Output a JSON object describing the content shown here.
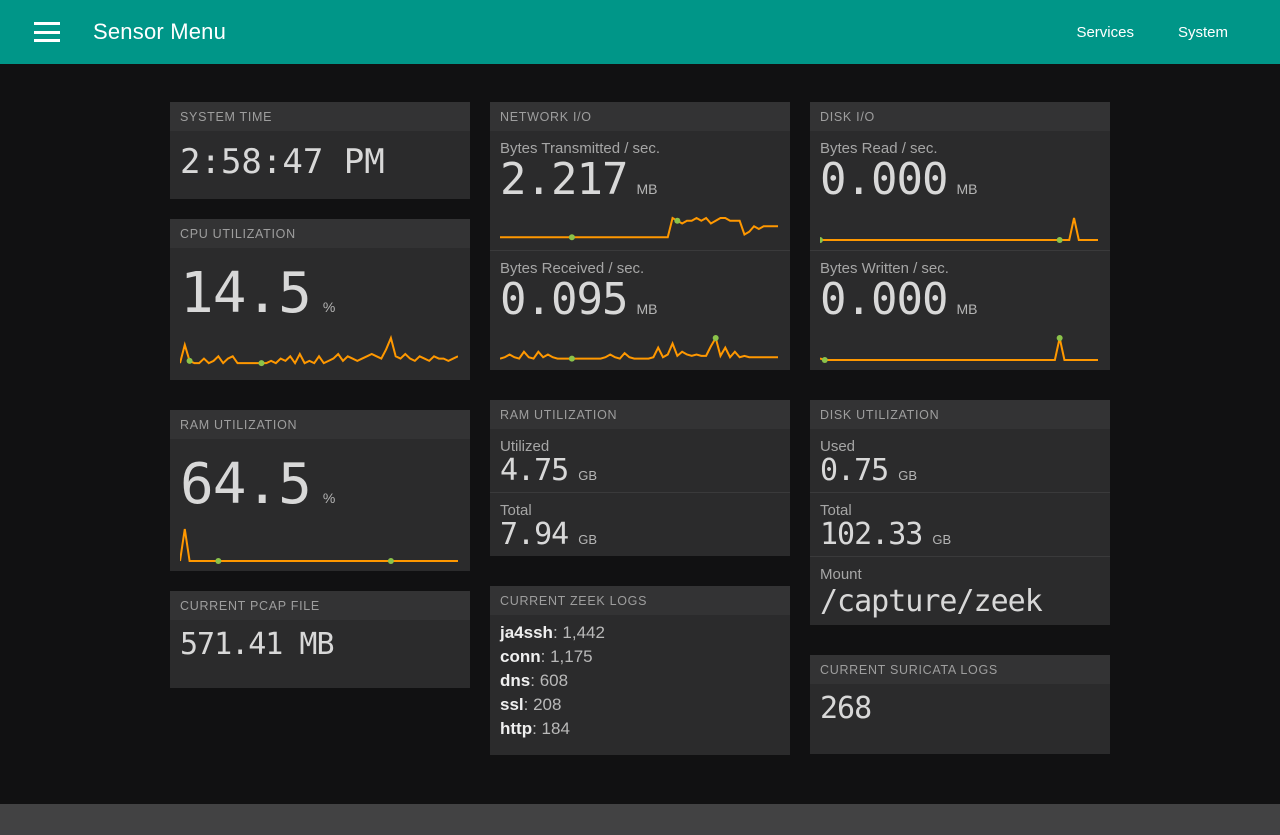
{
  "header": {
    "menu_icon": "hamburger-icon",
    "title": "Sensor Menu",
    "nav": [
      {
        "label": "Services"
      },
      {
        "label": "System"
      }
    ]
  },
  "cards": {
    "system_time": {
      "title": "SYSTEM TIME",
      "value": "2:58:47 PM"
    },
    "cpu_utilization": {
      "title": "CPU UTILIZATION",
      "value": "14.5",
      "unit": "%"
    },
    "ram_utilization_pct": {
      "title": "RAM UTILIZATION",
      "value": "64.5",
      "unit": "%"
    },
    "current_pcap_file": {
      "title": "CURRENT PCAP FILE",
      "value": "571.41 MB"
    },
    "network_io": {
      "title": "NETWORK I/O",
      "rows": [
        {
          "label": "Bytes Transmitted / sec.",
          "value": "2.217",
          "unit": "MB"
        },
        {
          "label": "Bytes Received / sec.",
          "value": "0.095",
          "unit": "MB"
        }
      ]
    },
    "ram_utilization_gb": {
      "title": "RAM UTILIZATION",
      "rows": [
        {
          "label": "Utilized",
          "value": "4.75",
          "unit": "GB"
        },
        {
          "label": "Total",
          "value": "7.94",
          "unit": "GB"
        }
      ]
    },
    "current_zeek_logs": {
      "title": "CURRENT ZEEK LOGS",
      "entries": [
        {
          "name": "ja4ssh",
          "count": "1,442"
        },
        {
          "name": "conn",
          "count": "1,175"
        },
        {
          "name": "dns",
          "count": "608"
        },
        {
          "name": "ssl",
          "count": "208"
        },
        {
          "name": "http",
          "count": "184"
        }
      ]
    },
    "disk_io": {
      "title": "DISK I/O",
      "rows": [
        {
          "label": "Bytes Read / sec.",
          "value": "0.000",
          "unit": "MB"
        },
        {
          "label": "Bytes Written / sec.",
          "value": "0.000",
          "unit": "MB"
        }
      ]
    },
    "disk_utilization": {
      "title": "DISK UTILIZATION",
      "rows": [
        {
          "label": "Used",
          "value": "0.75",
          "unit": "GB"
        },
        {
          "label": "Total",
          "value": "102.33",
          "unit": "GB"
        },
        {
          "label": "Mount",
          "value": "/capture/zeek"
        }
      ]
    },
    "current_suricata_logs": {
      "title": "CURRENT SURICATA LOGS",
      "value": "268"
    }
  },
  "colors": {
    "accent_teal": "#009688",
    "spark_line": "#ff9800",
    "spark_marker": "#8bc34a",
    "page_bg": "#111112",
    "card_bg": "#2b2b2c",
    "card_head_bg": "#333334"
  },
  "chart_data": [
    {
      "type": "line",
      "name": "cpu-utilization-sparkline",
      "ylabel": "%",
      "values": [
        3,
        11,
        4,
        3,
        3,
        5,
        3,
        4,
        6,
        3,
        5,
        6,
        3,
        3,
        3,
        3,
        3,
        3,
        3,
        4,
        3,
        5,
        4,
        6,
        3,
        7,
        3,
        4,
        3,
        6,
        3,
        4,
        5,
        7,
        4,
        6,
        5,
        4,
        5,
        6,
        7,
        6,
        5,
        9,
        14,
        6,
        5,
        7,
        5,
        4,
        6,
        5,
        4,
        6,
        5,
        5,
        4,
        5,
        6
      ],
      "markers": [
        2,
        17
      ]
    },
    {
      "type": "line",
      "name": "bytes-transmitted-sparkline",
      "ylabel": "MB",
      "values": [
        1,
        1,
        1,
        1,
        1,
        1,
        1,
        1,
        1,
        1,
        1,
        1,
        1,
        1,
        1,
        1,
        1,
        1,
        1,
        1,
        1,
        1,
        1,
        1,
        1,
        1,
        1,
        1,
        1,
        1,
        1,
        1,
        1,
        1,
        1,
        1,
        8,
        7,
        6,
        7,
        7,
        8,
        7,
        8,
        6,
        7,
        8,
        8,
        7,
        7,
        7,
        2,
        3,
        5,
        4,
        5,
        5,
        5,
        5
      ],
      "markers": [
        15,
        37
      ]
    },
    {
      "type": "line",
      "name": "bytes-received-sparkline",
      "ylabel": "MB",
      "values": [
        1,
        2,
        4,
        2,
        1,
        6,
        2,
        1,
        6,
        2,
        4,
        2,
        1,
        1,
        1,
        1,
        1,
        1,
        1,
        1,
        1,
        1,
        2,
        4,
        2,
        1,
        5,
        2,
        1,
        1,
        1,
        1,
        2,
        9,
        2,
        4,
        12,
        3,
        6,
        4,
        3,
        4,
        3,
        3,
        10,
        16,
        3,
        9,
        2,
        6,
        2,
        3,
        2,
        2,
        2,
        2,
        2,
        2,
        2
      ],
      "markers": [
        15,
        45
      ]
    },
    {
      "type": "line",
      "name": "bytes-read-sparkline",
      "ylabel": "MB",
      "values": [
        0,
        0,
        0,
        0,
        0,
        0,
        0,
        0,
        0,
        0,
        0,
        0,
        0,
        0,
        0,
        0,
        0,
        0,
        0,
        0,
        0,
        0,
        0,
        0,
        0,
        0,
        0,
        0,
        0,
        0,
        0,
        0,
        0,
        0,
        0,
        0,
        0,
        0,
        0,
        0,
        0,
        0,
        0,
        0,
        0,
        0,
        0,
        0,
        0,
        0,
        0,
        0,
        0,
        1,
        0,
        0,
        0,
        0,
        0
      ],
      "markers": [
        0,
        50
      ]
    },
    {
      "type": "line",
      "name": "bytes-written-sparkline",
      "ylabel": "MB",
      "values": [
        1,
        0,
        0,
        0,
        0,
        0,
        0,
        0,
        0,
        0,
        0,
        0,
        0,
        0,
        0,
        0,
        0,
        0,
        0,
        0,
        0,
        0,
        0,
        0,
        0,
        0,
        0,
        0,
        0,
        0,
        0,
        0,
        0,
        0,
        0,
        0,
        0,
        0,
        0,
        0,
        0,
        0,
        0,
        0,
        0,
        0,
        0,
        0,
        0,
        0,
        14,
        0,
        0,
        0,
        0,
        0,
        0,
        0,
        0
      ],
      "markers": [
        1,
        50
      ]
    },
    {
      "type": "line",
      "name": "ram-utilization-sparkline",
      "ylabel": "%",
      "values": [
        0,
        1,
        0,
        0,
        0,
        0,
        0,
        0,
        0,
        0,
        0,
        0,
        0,
        0,
        0,
        0,
        0,
        0,
        0,
        0,
        0,
        0,
        0,
        0,
        0,
        0,
        0,
        0,
        0,
        0,
        0,
        0,
        0,
        0,
        0,
        0,
        0,
        0,
        0,
        0,
        0,
        0,
        0,
        0,
        0,
        0,
        0,
        0,
        0,
        0,
        0,
        0,
        0,
        0,
        0,
        0,
        0,
        0,
        0
      ],
      "markers": [
        8,
        44
      ]
    }
  ]
}
